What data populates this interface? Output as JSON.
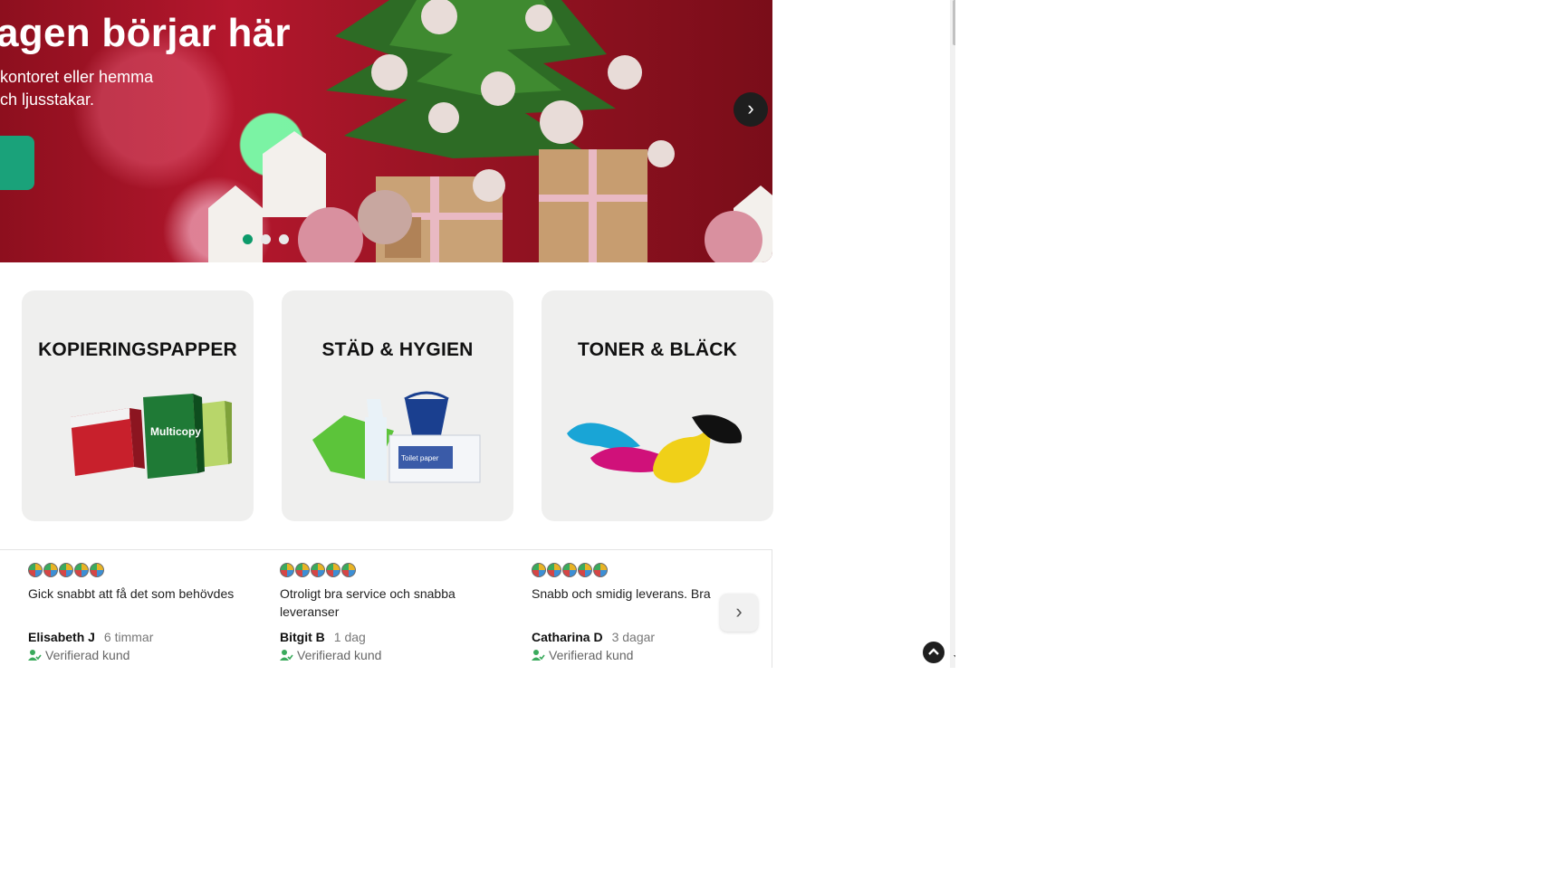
{
  "hero": {
    "title": "agen börjar här",
    "subtitle_line1": "kontoret eller hemma",
    "subtitle_line2": "ch ljusstakar.",
    "next_label": "›",
    "slide_count": 3,
    "active_slide": 1
  },
  "categories": [
    {
      "label": "KOPIERINGSPAPPER",
      "icon": "copy-paper-icon"
    },
    {
      "label": "STÄD & HYGIEN",
      "icon": "cleaning-icon"
    },
    {
      "label": "TONER & BLÄCK",
      "icon": "toner-ink-icon"
    }
  ],
  "reviews": {
    "items": [
      {
        "rating": 5,
        "text": "Gick snabbt att få det som behövdes",
        "name": "Elisabeth J",
        "time": "6 timmar",
        "verified": "Verifierad kund"
      },
      {
        "rating": 5,
        "text": "Otroligt bra service och snabba leveranser",
        "name": "Bitgit B",
        "time": "1 dag",
        "verified": "Verifierad kund"
      },
      {
        "rating": 5,
        "text": "Snabb och smidig leverans. Bra",
        "name": "Catharina D",
        "time": "3 dagar",
        "verified": "Verifierad kund"
      }
    ],
    "next_label": "›"
  },
  "colors": {
    "accent": "#0c9a6a",
    "hero_bg": "#a3162a",
    "card_bg": "#efefee"
  }
}
